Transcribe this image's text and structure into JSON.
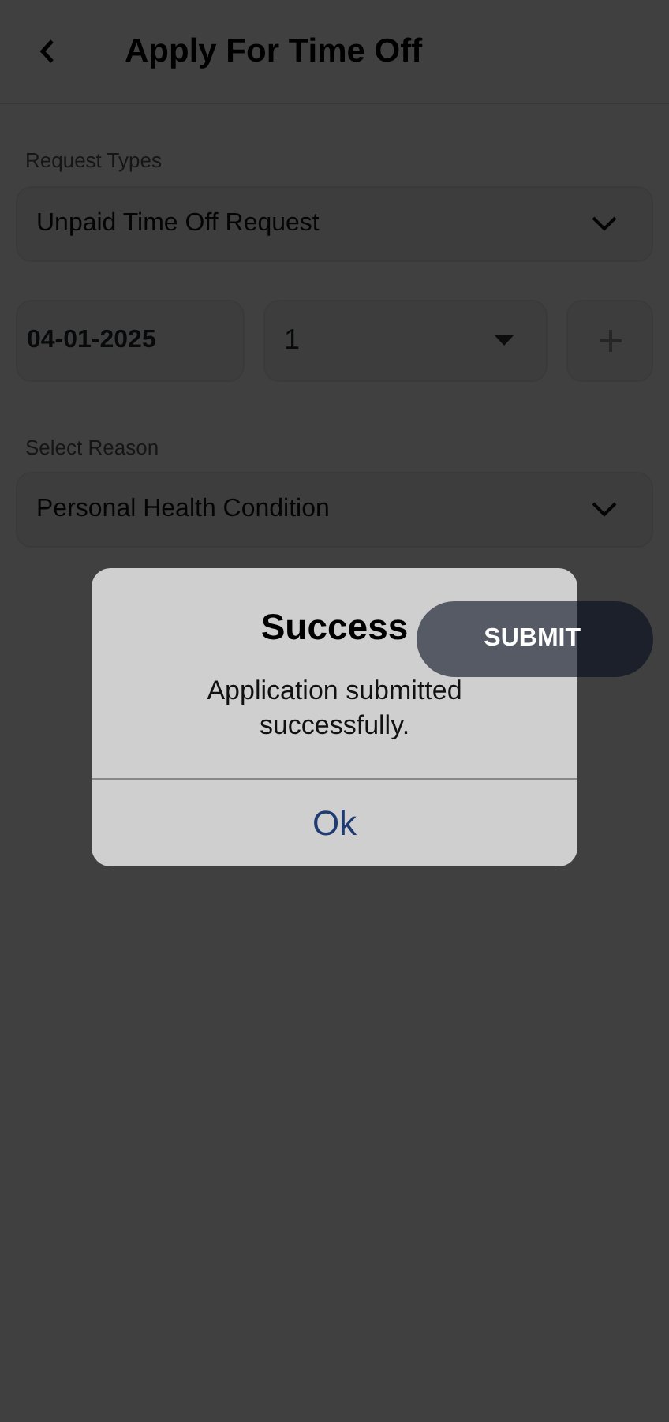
{
  "header": {
    "title": "Apply For Time Off"
  },
  "request_type": {
    "label": "Request Types",
    "value": "Unpaid Time Off Request"
  },
  "date_row": {
    "date": "04-01-2025",
    "count": "1"
  },
  "reason": {
    "label": "Select Reason",
    "value": "Personal Health Condition"
  },
  "submit_button": {
    "label": "SUBMIT"
  },
  "dialog": {
    "title": "Success",
    "message": "Application submitted successfully.",
    "button": "Ok"
  }
}
